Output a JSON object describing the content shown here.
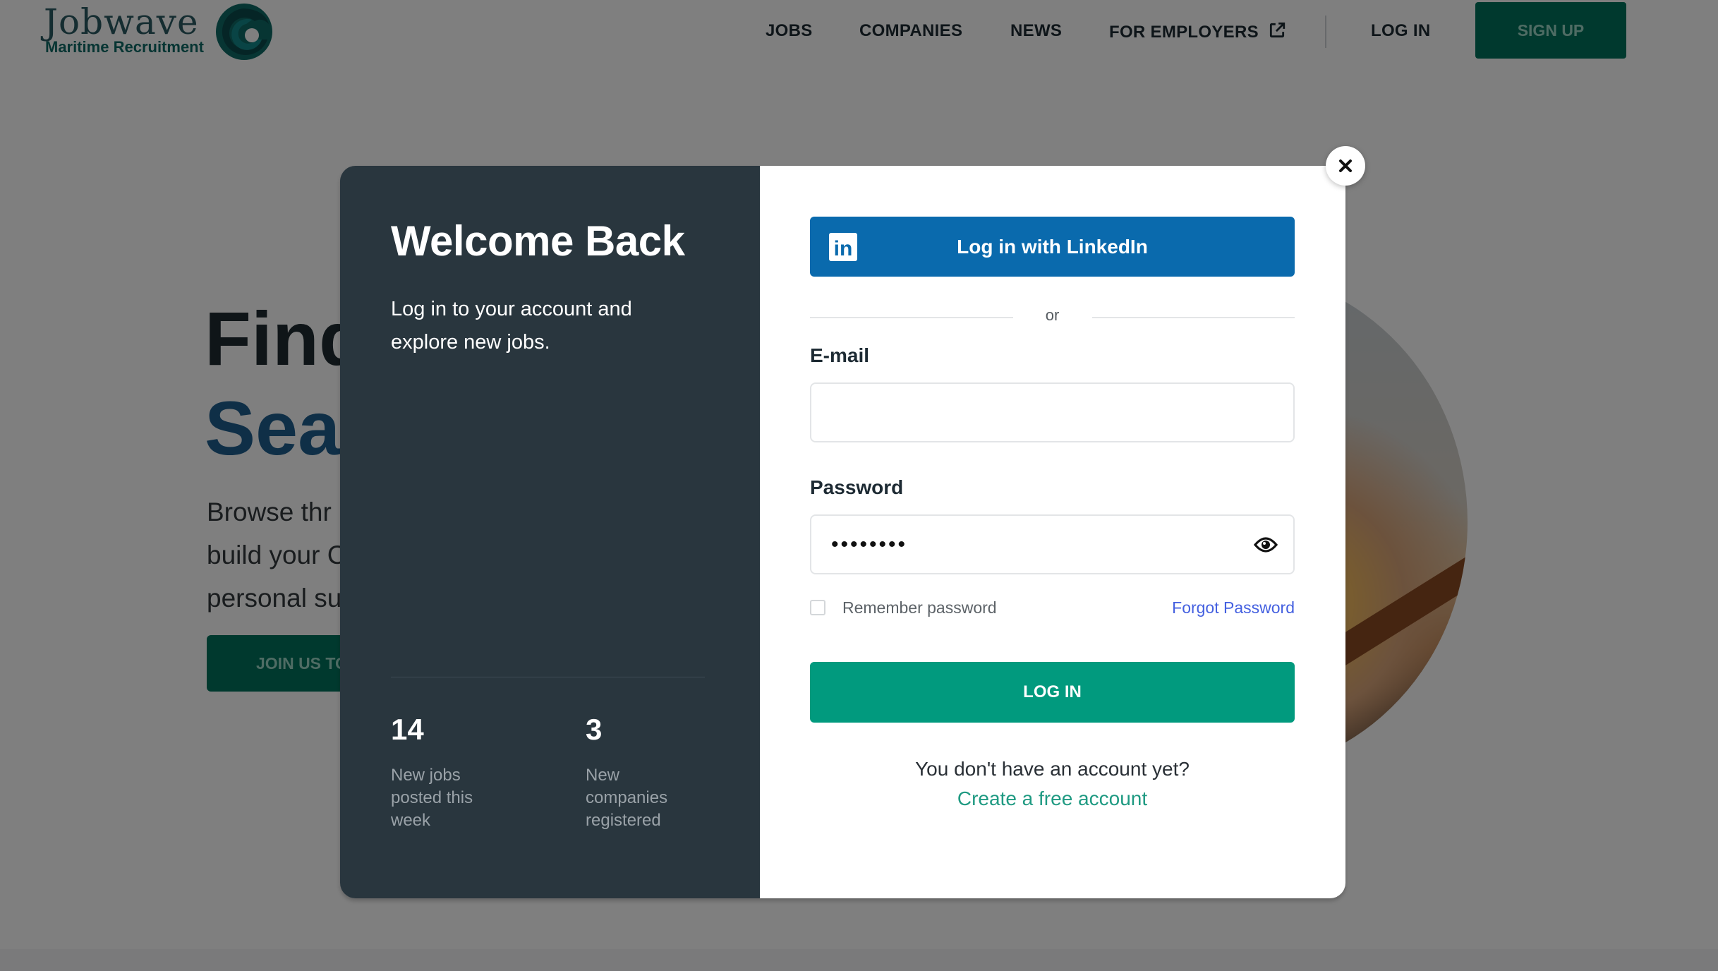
{
  "brand": {
    "name": "Jobwave",
    "tagline": "Maritime Recruitment",
    "colors": {
      "primary": "#00735c",
      "accent": "#019a7e",
      "linkedin": "#0a6aad",
      "dark_panel": "#29363e"
    }
  },
  "nav": {
    "items": [
      {
        "label": "JOBS"
      },
      {
        "label": "COMPANIES"
      },
      {
        "label": "NEWS"
      },
      {
        "label": "FOR EMPLOYERS",
        "icon": "external-link-icon"
      }
    ],
    "login_label": "LOG IN",
    "signup_label": "SIGN UP"
  },
  "hero": {
    "title_line1": "Find",
    "title_line2": "Sea",
    "desc_lines": [
      "Browse thr",
      "build your C",
      "personal su"
    ],
    "cta_label": "JOIN US TO"
  },
  "modal": {
    "left": {
      "title": "Welcome Back",
      "description": "Log in to your account and explore new jobs.",
      "stats": [
        {
          "value": "14",
          "label": "New jobs posted this week"
        },
        {
          "value": "3",
          "label": "New companies registered"
        }
      ]
    },
    "right": {
      "linkedin_label": "Log in with LinkedIn",
      "or_label": "or",
      "email": {
        "label": "E-mail",
        "value": "",
        "placeholder": ""
      },
      "password": {
        "label": "Password",
        "masked_value": "••••••••",
        "icon": "eye-icon"
      },
      "remember_label": "Remember password",
      "remember_checked": false,
      "forgot_label": "Forgot Password",
      "login_label": "LOG IN",
      "no_account_text": "You don't have an account yet?",
      "create_account_label": "Create a free account"
    },
    "close_icon": "close-icon"
  }
}
